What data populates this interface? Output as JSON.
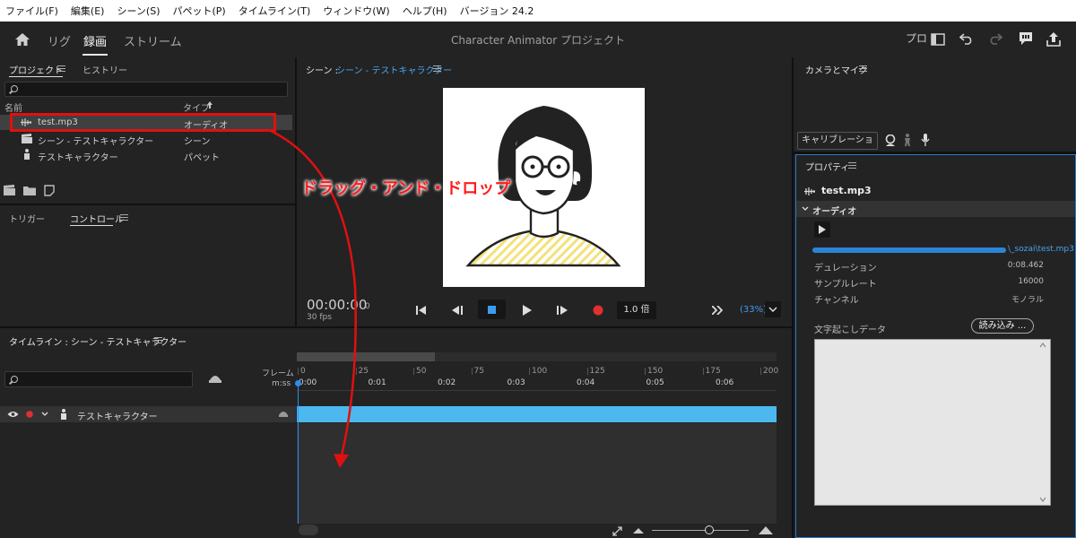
{
  "menu": [
    "ファイル(F)",
    "編集(E)",
    "シーン(S)",
    "パペット(P)",
    "タイムライン(T)",
    "ウィンドウ(W)",
    "ヘルプ(H)",
    "バージョン 24.2"
  ],
  "topbar": {
    "modes": [
      "リグ",
      "録画",
      "ストリーム"
    ],
    "title": "Character Animator プロジェクト",
    "pro_label": "プロ"
  },
  "project": {
    "tabs": [
      "プロジェクト",
      "ヒストリー"
    ],
    "col_name": "名前",
    "col_type": "タイプ",
    "items": [
      {
        "name": "test.mp3",
        "type": "オーディオ",
        "icon": "audio-icon"
      },
      {
        "name": "シーン - テストキャラクター",
        "type": "シーン",
        "icon": "scene-icon"
      },
      {
        "name": "テストキャラクター",
        "type": "パペット",
        "icon": "puppet-icon"
      }
    ]
  },
  "controls_panel": {
    "tabs": [
      "トリガー",
      "コントロール"
    ]
  },
  "scene": {
    "tab_prefix": "シーン : ",
    "tab_name": "シーン - テストキャラクター",
    "timecode": "00:00:00",
    "frame": "0",
    "fps": "30 fps",
    "speed": "1.0 倍",
    "zoom": "(33%)"
  },
  "camera": {
    "tab": "カメラとマイク",
    "calibrate": "キャリブレーション"
  },
  "properties": {
    "tab": "プロパティ",
    "file": "test.mp3",
    "section": "オーディオ",
    "path": "\\_sozai\\test.mp3",
    "rows": [
      {
        "label": "デュレーション",
        "value": "0:08.462"
      },
      {
        "label": "サンプルレート",
        "value": "16000"
      },
      {
        "label": "チャンネル",
        "value": "モノラル"
      }
    ],
    "transcript_label": "文字起こしデータ",
    "load_button": "読み込み ..."
  },
  "timeline": {
    "tab": "タイムライン : シーン - テストキャラクター",
    "frame_label": "フレーム",
    "mss_label": "m:ss",
    "frame_ticks": [
      "0",
      "25",
      "50",
      "75",
      "100",
      "125",
      "150",
      "175",
      "200"
    ],
    "time_ticks": [
      "0:00",
      "0:01",
      "0:02",
      "0:03",
      "0:04",
      "0:05",
      "0:06"
    ],
    "track_name": "テストキャラクター"
  },
  "annotation": {
    "text": "ドラッグ・アンド・ドロップ"
  },
  "colors": {
    "accent": "#2d8ceb",
    "clip": "#4db8ee",
    "annotation": "#e01010"
  }
}
